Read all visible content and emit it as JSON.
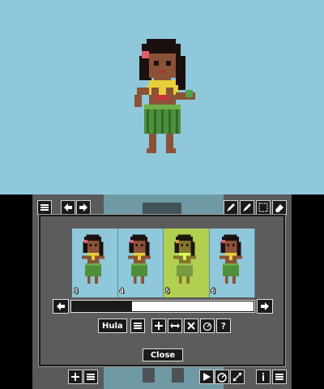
{
  "animation": {
    "name": "Hula",
    "frame_numbers": [
      "3",
      "4",
      "5",
      "6"
    ],
    "selected_frame": "5"
  },
  "dialog": {
    "close_label": "Close",
    "help_label": "?"
  },
  "colors": {
    "canvas_bg": "#8ec8da",
    "selected_frame_bg": "#b2cf52",
    "panel_bg": "#5c5c5c",
    "button_bg": "#1a1a1a"
  },
  "toolbar": {
    "top_left_icons": [
      "menu-icon",
      "undo-arrow-icon",
      "redo-arrow-icon"
    ],
    "top_right_icons": [
      "pen-icon",
      "pen-icon",
      "select-icon",
      "eraser-icon"
    ],
    "bottom_icons": [
      "add-icon",
      "list-icon",
      "play-icon",
      "speed-icon",
      "resize-icon",
      "info-icon",
      "menu-icon"
    ]
  }
}
